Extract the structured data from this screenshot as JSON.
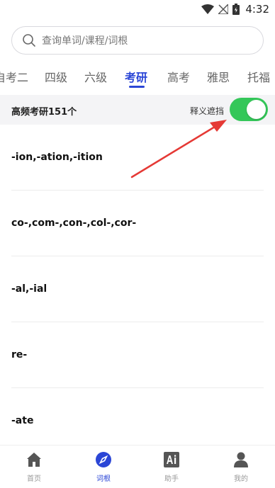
{
  "status_bar": {
    "time": "4:32"
  },
  "search": {
    "placeholder": "查询单词/课程/词根"
  },
  "tabs": [
    {
      "label": "自考二"
    },
    {
      "label": "四级"
    },
    {
      "label": "六级"
    },
    {
      "label": "考研",
      "active": true
    },
    {
      "label": "高考"
    },
    {
      "label": "雅思"
    },
    {
      "label": "托福"
    }
  ],
  "header_bar": {
    "count_label": "高频考研151个",
    "mask_label": "释义遮挡",
    "mask_enabled": true
  },
  "roots": [
    {
      "word": "-ion,-ation,-ition"
    },
    {
      "word": "co-,com-,con-,col-,cor-"
    },
    {
      "word": "-al,-ial"
    },
    {
      "word": "re-"
    },
    {
      "word": "-ate"
    }
  ],
  "bottom_nav": [
    {
      "label": "首页",
      "icon": "home-icon"
    },
    {
      "label": "词根",
      "icon": "compass-icon",
      "active": true
    },
    {
      "label": "助手",
      "icon": "ai-icon"
    },
    {
      "label": "我的",
      "icon": "person-icon"
    }
  ],
  "colors": {
    "accent": "#2b46d6",
    "toggle_on": "#34c759",
    "annotation_arrow": "#e53935"
  }
}
